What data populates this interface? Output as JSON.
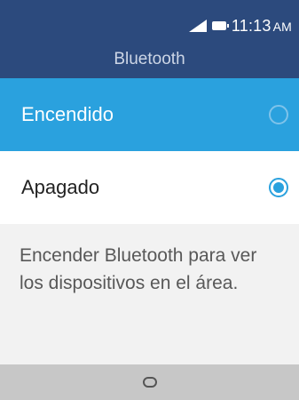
{
  "status_bar": {
    "time": "11:13",
    "ampm": "AM",
    "signal_icon": "signal-icon",
    "battery_icon": "battery-icon"
  },
  "header": {
    "title": "Bluetooth"
  },
  "options": [
    {
      "label": "Encendido",
      "selected": false,
      "highlighted": true
    },
    {
      "label": "Apagado",
      "selected": true,
      "highlighted": false
    }
  ],
  "description": "Encender Bluetooth para ver los dispositivos en el área.",
  "softkeys": {
    "center_icon": "circle-select-icon"
  },
  "colors": {
    "header_bg": "#2c4a7d",
    "highlight": "#2aa1de",
    "softkey_bg": "#c7c7c7"
  }
}
